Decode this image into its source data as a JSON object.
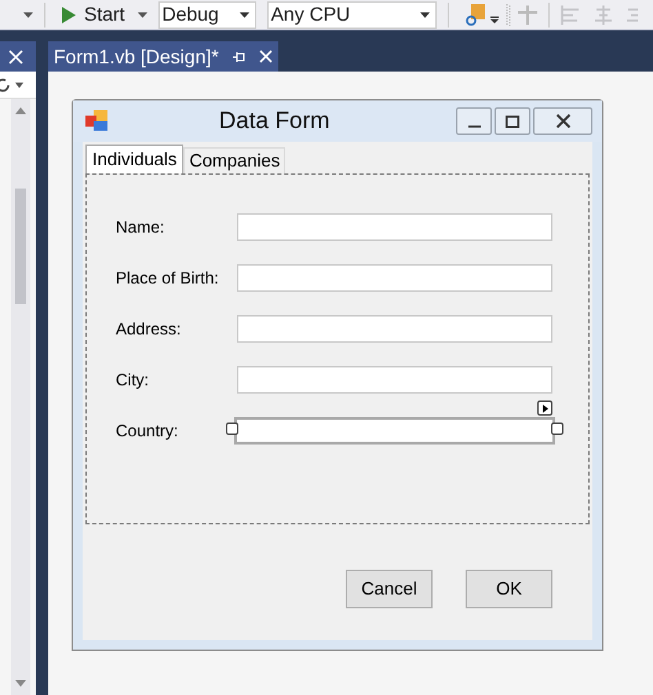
{
  "toolbar": {
    "start_button": "Start",
    "configuration": "Debug",
    "platform": "Any CPU"
  },
  "document_tab": {
    "title": "Form1.vb [Design]*",
    "selected": true
  },
  "form": {
    "title": "Data Form",
    "tabs": [
      {
        "label": "Individuals",
        "selected": true
      },
      {
        "label": "Companies",
        "selected": false
      }
    ],
    "fields": [
      {
        "label": "Name:",
        "selected": false
      },
      {
        "label": "Place of Birth:",
        "selected": false
      },
      {
        "label": "Address:",
        "selected": false
      },
      {
        "label": "City:",
        "selected": false
      },
      {
        "label": "Country:",
        "selected": true
      }
    ],
    "buttons": [
      "Cancel",
      "OK"
    ]
  }
}
